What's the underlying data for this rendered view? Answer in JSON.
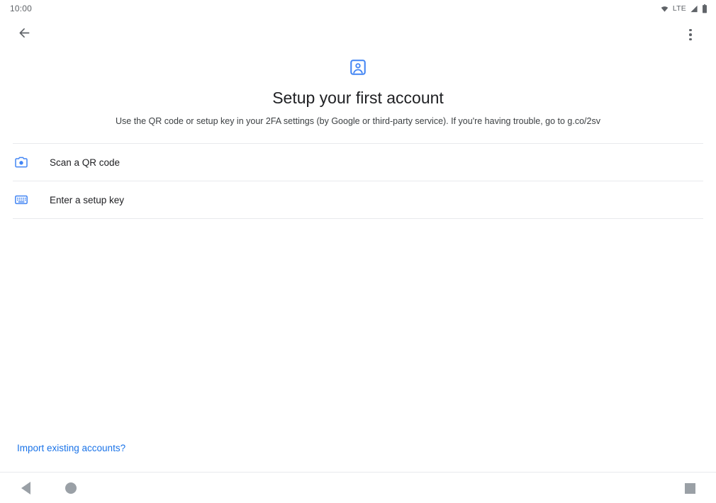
{
  "status_bar": {
    "clock": "10:00",
    "network_label": "LTE",
    "icons": {
      "wifi": "wifi-icon",
      "signal": "signal-icon",
      "battery": "battery-icon"
    }
  },
  "app_bar": {
    "back_icon": "arrow-back-icon",
    "overflow_icon": "more-vert-icon"
  },
  "hero": {
    "icon": "account-box-icon",
    "title": "Setup your first account",
    "subtitle": "Use the QR code or setup key in your 2FA settings (by Google or third-party service). If you're having trouble, go to g.co/2sv"
  },
  "options": [
    {
      "icon": "camera-icon",
      "label": "Scan a QR code"
    },
    {
      "icon": "keyboard-icon",
      "label": "Enter a setup key"
    }
  ],
  "footer": {
    "import_link": "Import existing accounts?"
  },
  "nav_bar": {
    "back": "nav-back-icon",
    "home": "nav-home-icon",
    "recents": "nav-recents-icon"
  },
  "colors": {
    "accent": "#1a73e8",
    "text_primary": "#202124",
    "text_secondary": "#5f6368",
    "divider": "#e8eaed",
    "nav_gray": "#9aa0a6"
  }
}
